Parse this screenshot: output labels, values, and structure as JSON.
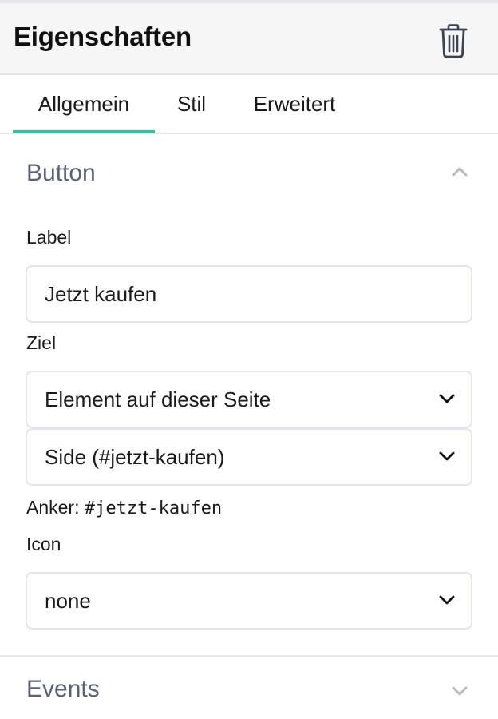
{
  "header": {
    "title": "Eigenschaften",
    "delete_icon": "trash-icon"
  },
  "tabs": [
    {
      "label": "Allgemein",
      "active": true
    },
    {
      "label": "Stil",
      "active": false
    },
    {
      "label": "Erweitert",
      "active": false
    }
  ],
  "sections": {
    "button": {
      "title": "Button",
      "expanded": true,
      "fields": {
        "label": {
          "label": "Label",
          "value": "Jetzt kaufen"
        },
        "target": {
          "label": "Ziel",
          "type_value": "Element auf dieser Seite",
          "element_value": "Side (#jetzt-kaufen)",
          "anchor_prefix": "Anker:",
          "anchor_value": "#jetzt-kaufen"
        },
        "icon": {
          "label": "Icon",
          "value": "none"
        }
      }
    },
    "events": {
      "title": "Events",
      "expanded": false
    }
  },
  "colors": {
    "accent": "#2fc49a",
    "section_title": "#5b6172",
    "border": "#e4e5e8",
    "header_bg": "#f6f6f7"
  }
}
